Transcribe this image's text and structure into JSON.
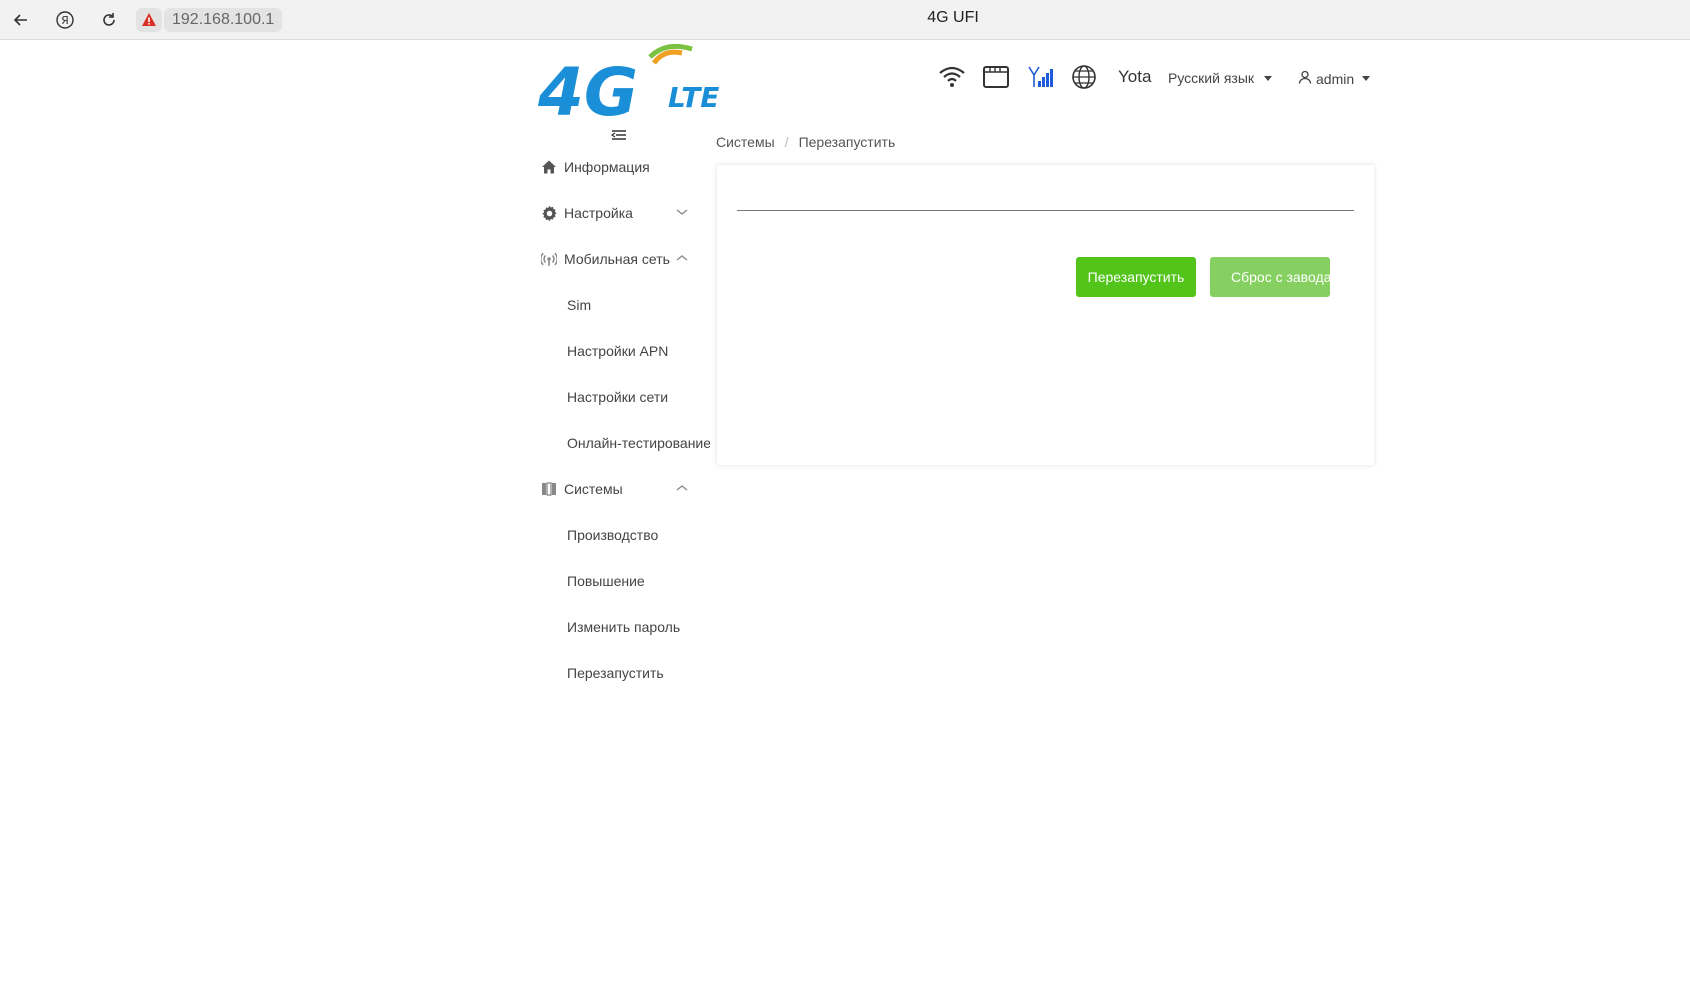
{
  "browser": {
    "url": "192.168.100.1",
    "tab_title": "4G UFI"
  },
  "header": {
    "logo_text": "4G LTE",
    "operator": "Yota",
    "language": "Русский язык",
    "user": "admin"
  },
  "sidebar": {
    "items": [
      {
        "label": "Информация",
        "icon": "home-icon"
      },
      {
        "label": "Настройка",
        "icon": "gear-icon"
      },
      {
        "label": "Мобильная сеть",
        "icon": "signal-icon"
      },
      {
        "label": "Системы",
        "icon": "system-icon"
      }
    ],
    "mobile_sub": [
      "Sim",
      "Настройки APN",
      "Настройки сети",
      "Онлайн-тестирование"
    ],
    "system_sub": [
      "Производство",
      "Повышение",
      "Изменить пароль",
      "Перезапустить"
    ]
  },
  "breadcrumb": {
    "parent": "Системы",
    "separator": "/",
    "current": "Перезапустить"
  },
  "main": {
    "restart_label": "Перезапустить",
    "reset_label": "Сброс с завода"
  },
  "colors": {
    "primary_green": "#52c41a",
    "light_green": "#85d060",
    "signal_blue": "#1e5bd8"
  }
}
